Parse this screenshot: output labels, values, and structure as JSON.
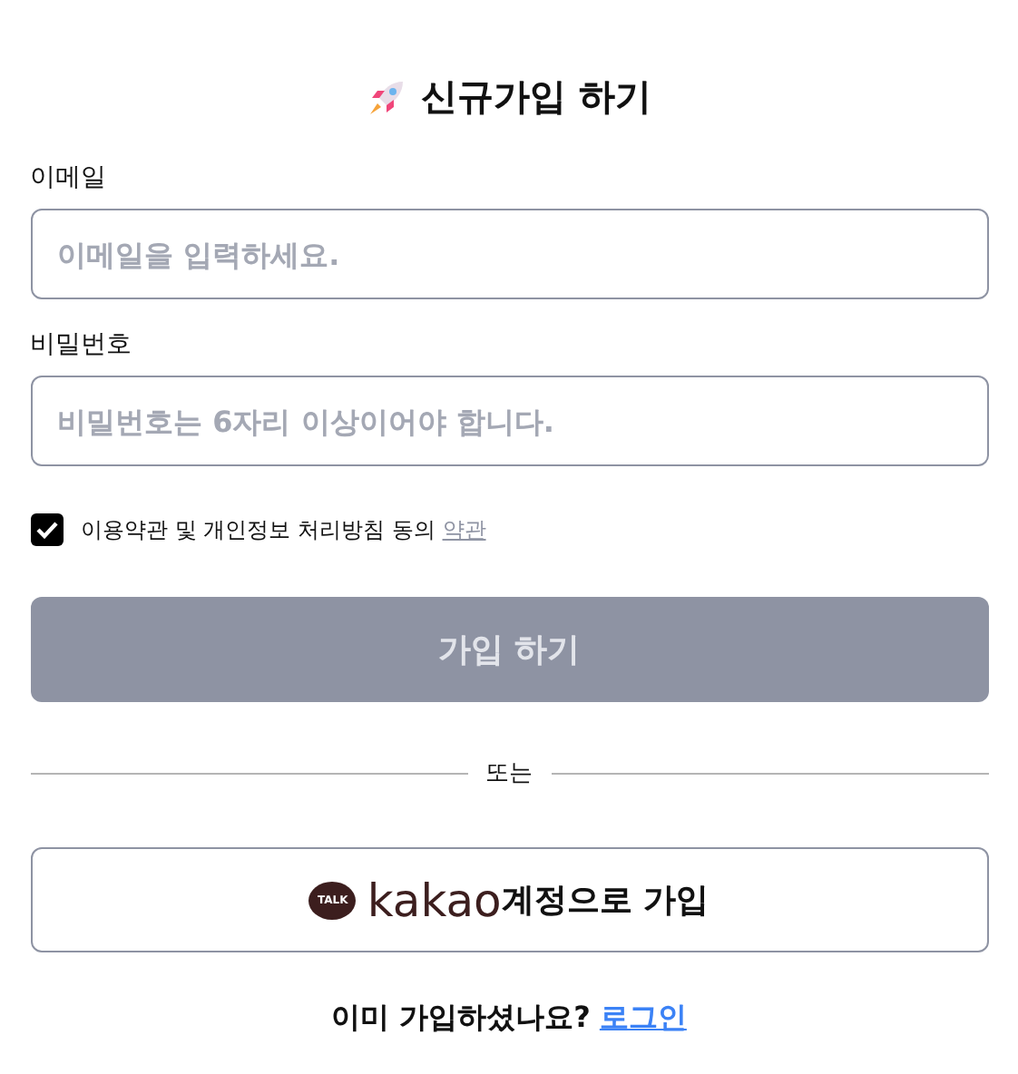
{
  "title": "신규가입 하기",
  "fields": [
    {
      "label": "이메일",
      "placeholder": "이메일을 입력하세요."
    },
    {
      "label": "비밀번호",
      "placeholder": "비밀번호는 6자리 이상이어야 합니다."
    }
  ],
  "agreement": {
    "checked": true,
    "text": "이용약관 및 개인정보 처리방침 동의",
    "link": "약관"
  },
  "submit": {
    "label": "가입 하기",
    "disabled": true
  },
  "divider": "또는",
  "kakao": {
    "badge": "TALK",
    "brand": "kakao",
    "label": "계정으로 가입"
  },
  "footer": {
    "text": "이미 가입하셨나요?",
    "link": "로그인"
  }
}
